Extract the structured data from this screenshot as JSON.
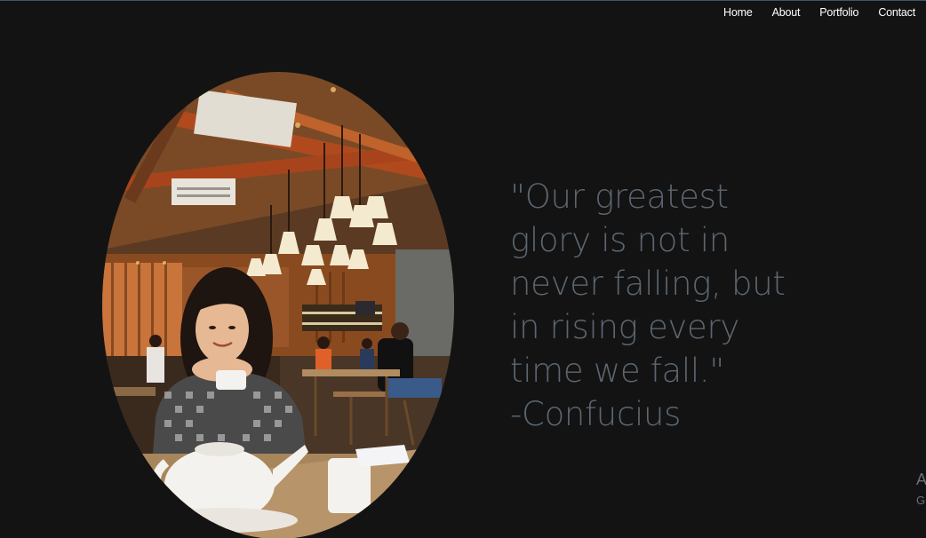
{
  "nav": {
    "items": [
      {
        "label": "Home"
      },
      {
        "label": "About"
      },
      {
        "label": "Portfolio"
      },
      {
        "label": "Contact"
      }
    ]
  },
  "quote": {
    "lines": [
      "\"Our greatest",
      "glory is not in",
      "never falling, but",
      "in rising every",
      "time we fall.\"",
      "-Confucius"
    ]
  },
  "side_text": {
    "line1": "A",
    "line2": "G"
  },
  "colors": {
    "background": "#131313",
    "quote_text": "#5c6670",
    "nav_text": "#ffffff"
  }
}
